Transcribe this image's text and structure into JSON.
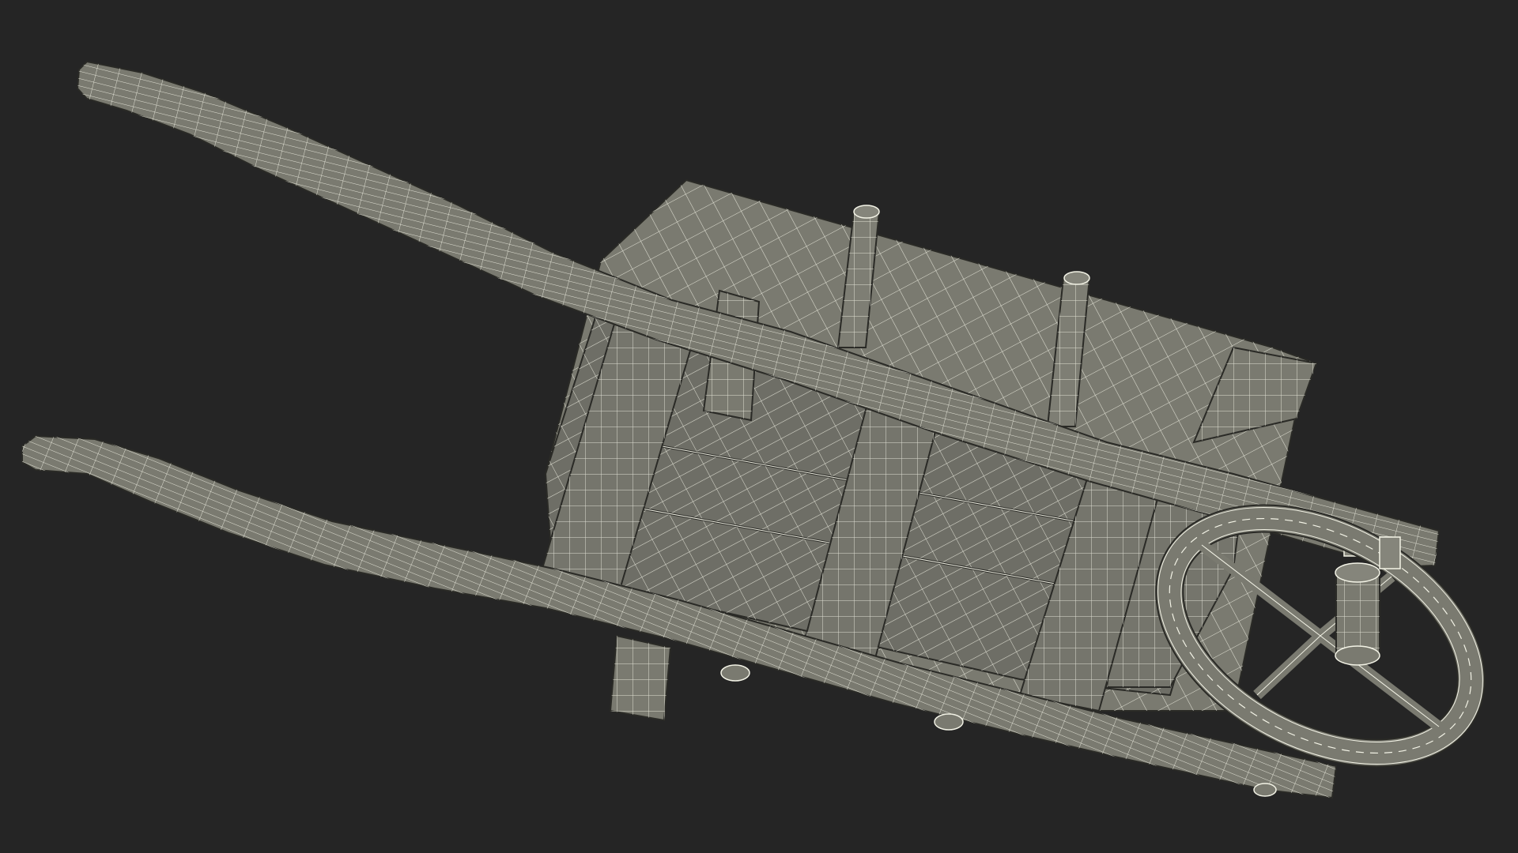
{
  "scene": {
    "subject": "wheelbarrow-wireframe",
    "background_color": "#252525",
    "surface_color": "#7a7a70",
    "surface_dark_color": "#6a6a62",
    "surface_light_color": "#85857b",
    "wire_color": "#f3f3e6",
    "edge_color": "#2a2a26"
  }
}
